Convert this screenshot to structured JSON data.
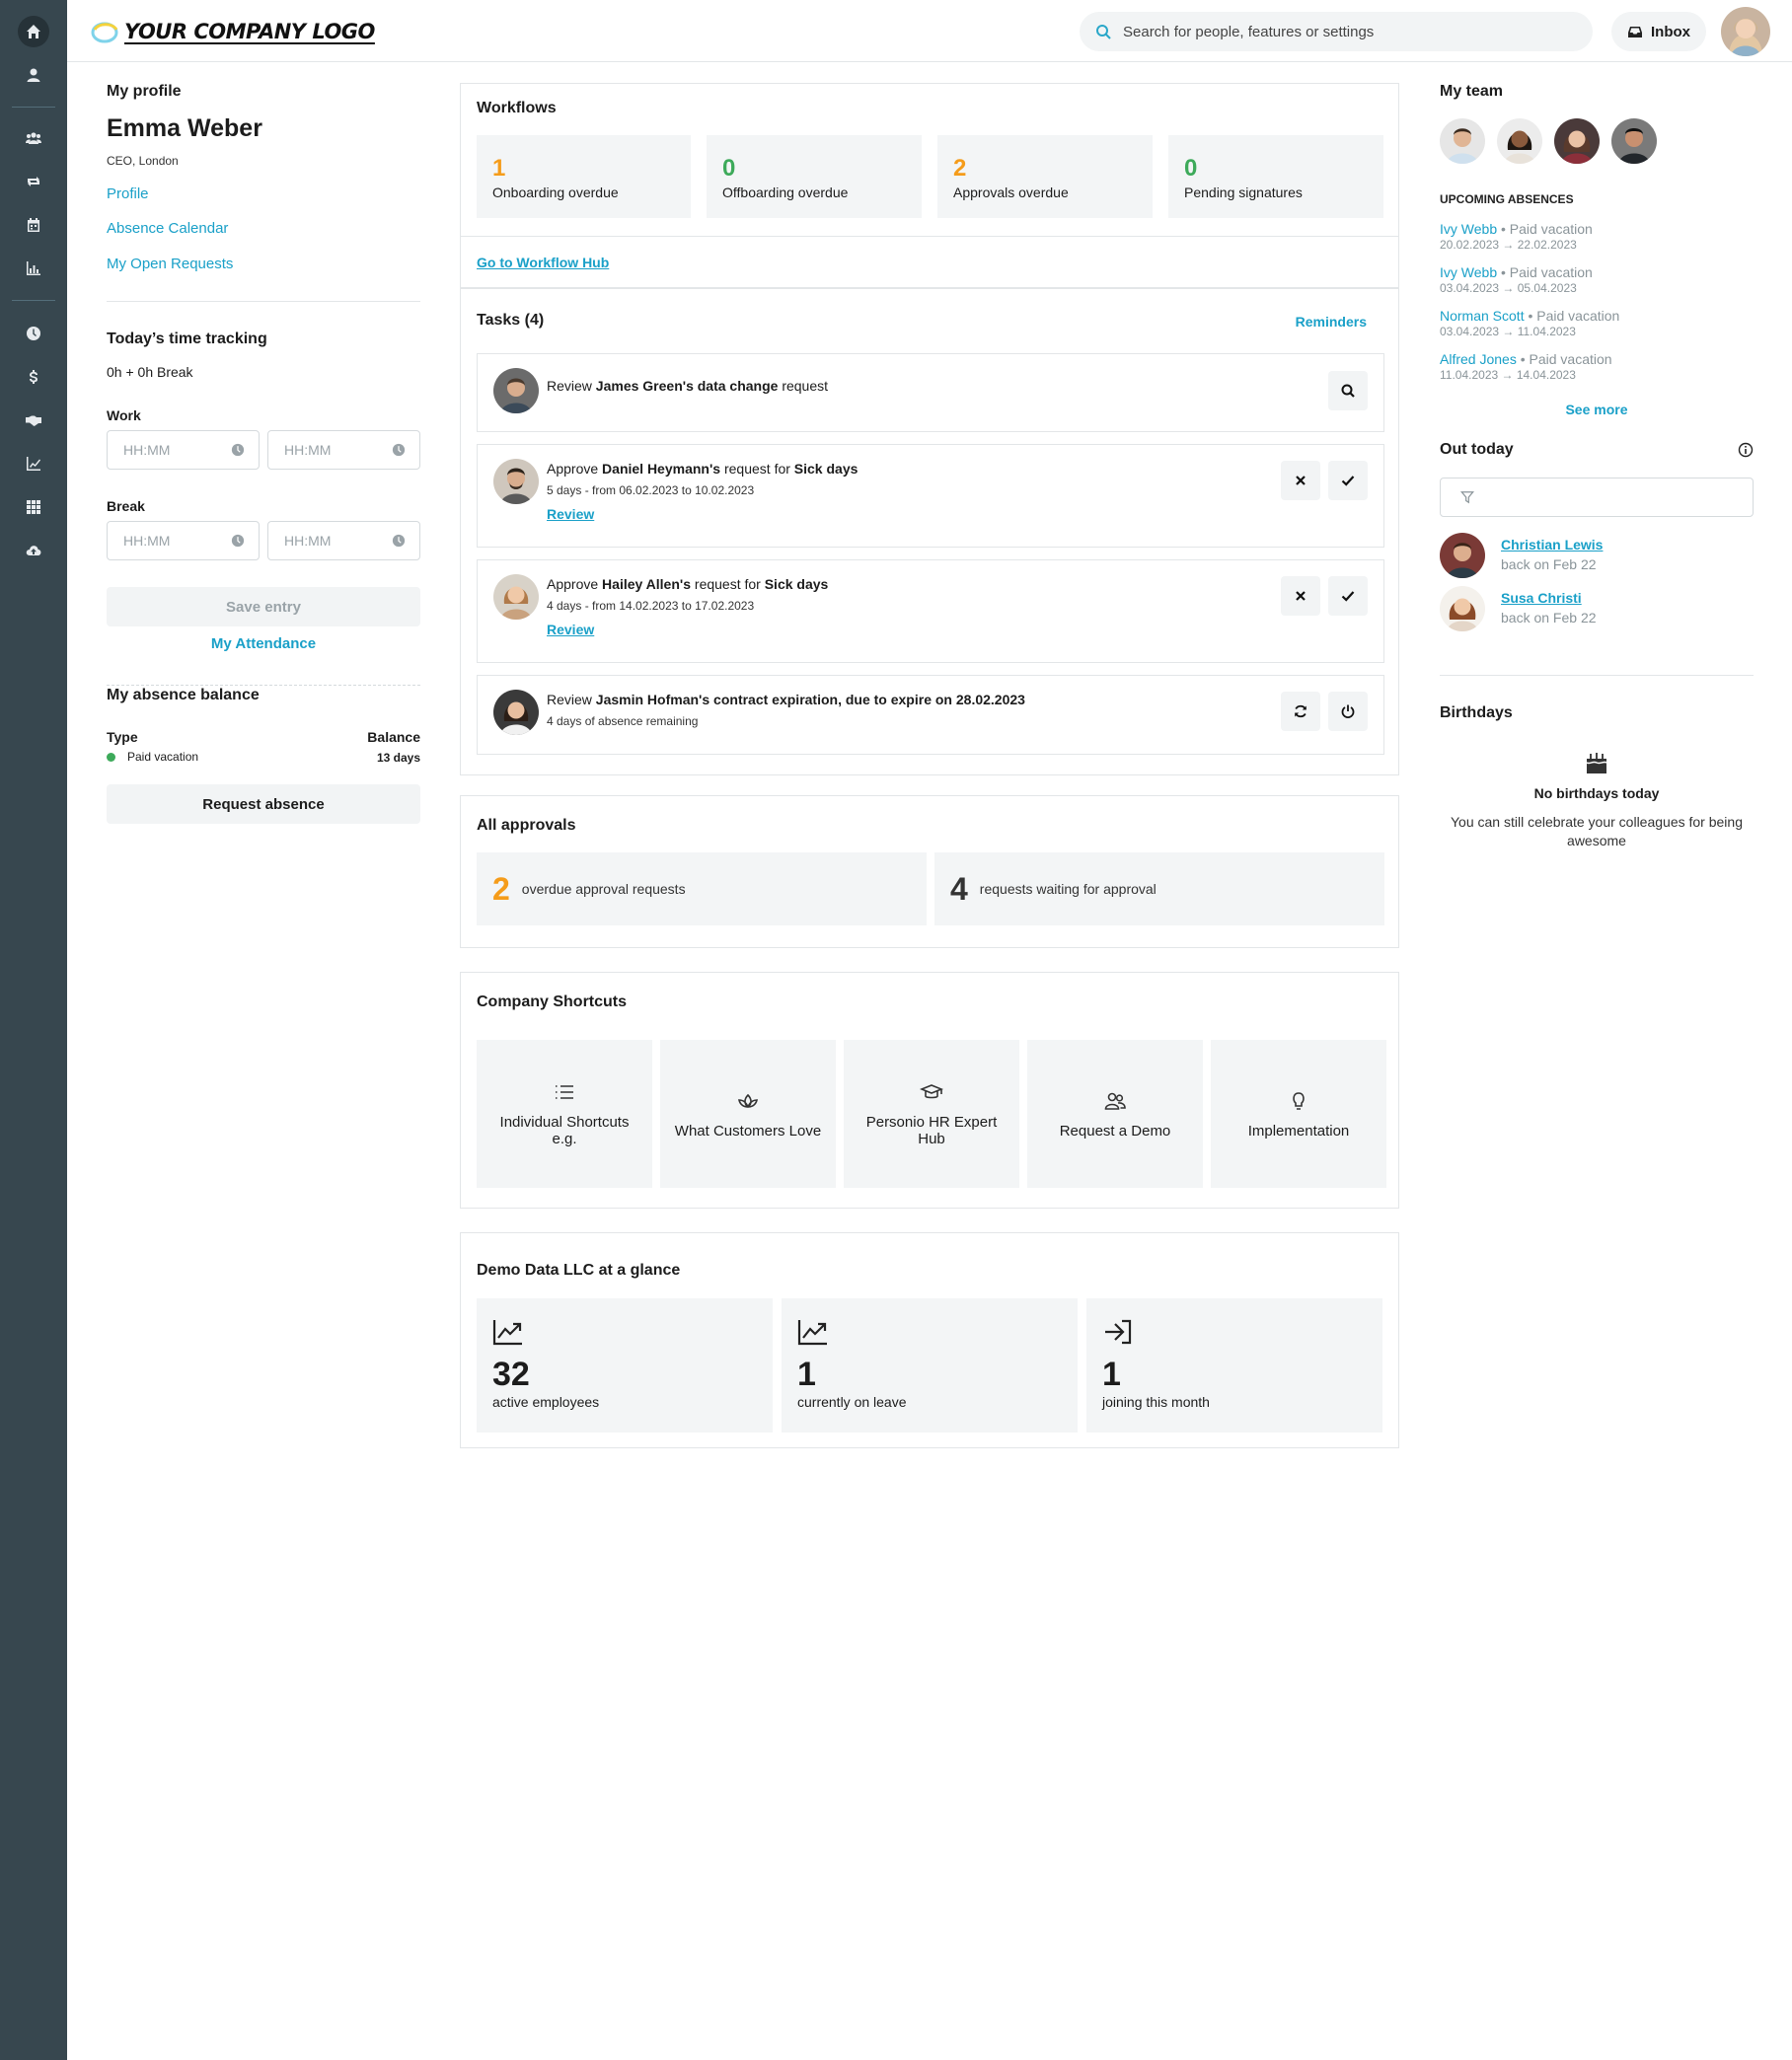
{
  "app": {
    "logo_text": "YOUR COMPANY LOGO"
  },
  "top_bar": {
    "search_placeholder": "Search for people, features or settings",
    "inbox_label": "Inbox"
  },
  "sidebar": {
    "icons": [
      "home-icon",
      "user-icon",
      "people-icon",
      "sync-icon",
      "calendar-icon",
      "bar-chart-icon",
      "clock-icon",
      "dollar-icon",
      "handshake-icon",
      "line-chart-icon",
      "grid-icon",
      "cloud-upload-icon"
    ]
  },
  "profile": {
    "section_title": "My profile",
    "name": "Emma Weber",
    "role": "CEO, London",
    "links": [
      "Profile",
      "Absence Calendar",
      "My Open Requests"
    ]
  },
  "time_tracking": {
    "title": "Today’s time tracking",
    "summary": "0h + 0h Break",
    "work_label": "Work",
    "break_label": "Break",
    "placeholder": "HH:MM",
    "save_label": "Save entry",
    "attendance_link": "My Attendance"
  },
  "absence_balance": {
    "title": "My absence balance",
    "type_header": "Type",
    "balance_header": "Balance",
    "type": "Paid vacation",
    "balance": "13 days",
    "request_label": "Request absence",
    "status_color": "#3daa5a"
  },
  "workflows": {
    "title": "Workflows",
    "tiles": [
      {
        "value": "1",
        "label": "Onboarding overdue"
      },
      {
        "value": "0",
        "label": "Offboarding overdue"
      },
      {
        "value": "2",
        "label": "Approvals overdue"
      },
      {
        "value": "0",
        "label": "Pending signatures"
      }
    ],
    "hub_link": "Go to Workflow Hub"
  },
  "tasks": {
    "title": "Tasks (4)",
    "reminders": "Reminders",
    "review": "Review",
    "items": [
      {
        "pre": "Review ",
        "b1": "James Green's data change",
        "mid": " request",
        "b2": "",
        "post": "",
        "sub": ""
      },
      {
        "pre": "Approve ",
        "b1": "Daniel Heymann's",
        "mid": " request for ",
        "b2": "Sick days",
        "post": "",
        "sub": "5 days - from 06.02.2023 to 10.02.2023"
      },
      {
        "pre": "Approve ",
        "b1": "Hailey Allen's",
        "mid": " request for ",
        "b2": "Sick days",
        "post": "",
        "sub": "4 days - from 14.02.2023 to 17.02.2023"
      },
      {
        "pre": "Review ",
        "b1": "Jasmin Hofman's contract expiration, due to expire on 28.02.2023",
        "mid": "",
        "b2": "",
        "post": "",
        "sub": "4 days of absence remaining"
      }
    ]
  },
  "approvals": {
    "title": "All approvals",
    "overdue_value": "2",
    "overdue_label": "overdue approval requests",
    "waiting_value": "4",
    "waiting_label": "requests waiting for approval"
  },
  "shortcuts": {
    "title": "Company Shortcuts",
    "items": [
      {
        "label": "Individual Shortcuts e.g.",
        "icon": "list-icon"
      },
      {
        "label": "What Customers Love",
        "icon": "lotus-icon"
      },
      {
        "label": "Personio HR Expert Hub",
        "icon": "graduation-cap-icon"
      },
      {
        "label": "Request a Demo",
        "icon": "users-icon"
      },
      {
        "label": "Implementation",
        "icon": "lightbulb-icon"
      }
    ]
  },
  "glance": {
    "title": "Demo Data LLC at a glance",
    "items": [
      {
        "value": "32",
        "label": "active employees",
        "icon": "trending-up-icon"
      },
      {
        "value": "1",
        "label": "currently on leave",
        "icon": "trending-up-icon"
      },
      {
        "value": "1",
        "label": "joining this month",
        "icon": "sign-in-icon"
      }
    ]
  },
  "team": {
    "title": "My team",
    "upcoming_title": "UPCOMING ABSENCES",
    "absences": [
      {
        "name": "Ivy Webb",
        "type": " • Paid vacation",
        "dates": "20.02.2023 → 22.02.2023"
      },
      {
        "name": "Ivy Webb",
        "type": " • Paid vacation",
        "dates": "03.04.2023 → 05.04.2023"
      },
      {
        "name": "Norman Scott",
        "type": " • Paid vacation",
        "dates": "03.04.2023 → 11.04.2023"
      },
      {
        "name": "Alfred Jones",
        "type": " • Paid vacation",
        "dates": "11.04.2023 → 14.04.2023"
      }
    ],
    "see_more": "See more"
  },
  "out_today": {
    "title": "Out today",
    "people": [
      {
        "name": "Christian Lewis",
        "back": "back on Feb 22"
      },
      {
        "name": "Susa Christi",
        "back": "back on Feb 22"
      }
    ]
  },
  "birthdays": {
    "title": "Birthdays",
    "empty_title": "No birthdays today",
    "empty_text": "You can still celebrate your colleagues for being awesome"
  },
  "colors": {
    "accent": "#1aa0c8",
    "sidebar": "#37474f",
    "orange": "#f59c1a",
    "green": "#3daa5a"
  }
}
